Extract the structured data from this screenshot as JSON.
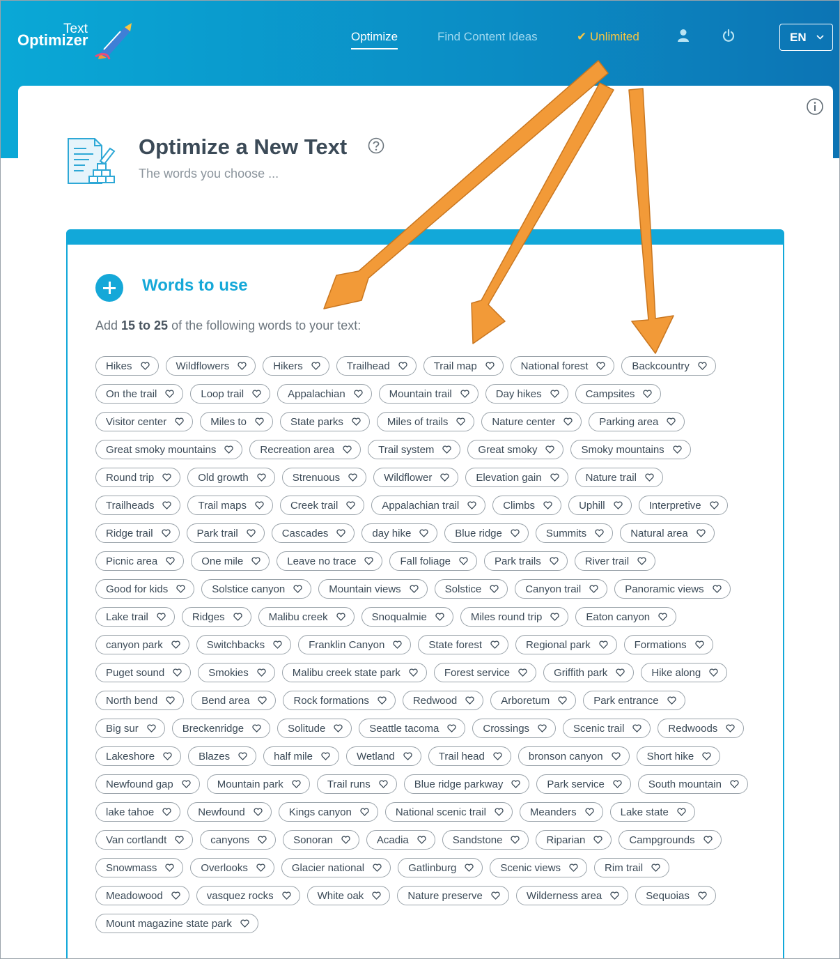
{
  "header": {
    "logo_small": "Text",
    "logo_big": "Optimizer",
    "nav": {
      "optimize": "Optimize",
      "find_content": "Find Content Ideas",
      "unlimited": "✔ Unlimited"
    },
    "language": "EN",
    "icons": [
      "user-icon",
      "power-icon",
      "chevron-down-icon"
    ]
  },
  "page": {
    "title": "Optimize a New Text",
    "subtitle": "The words you choose ...",
    "icons": [
      "info-icon",
      "help-icon",
      "document-edit-icon"
    ]
  },
  "panel": {
    "heading": "Words to use",
    "instruction_prefix": "Add ",
    "instruction_range": "15 to 25",
    "instruction_suffix": " of the following words to your text:",
    "words": [
      "Hikes",
      "Wildflowers",
      "Hikers",
      "Trailhead",
      "Trail map",
      "National forest",
      "Backcountry",
      "On the trail",
      "Loop trail",
      "Appalachian",
      "Mountain trail",
      "Day hikes",
      "Campsites",
      "Visitor center",
      "Miles to",
      "State parks",
      "Miles of trails",
      "Nature center",
      "Parking area",
      "Great smoky mountains",
      "Recreation area",
      "Trail system",
      "Great smoky",
      "Smoky mountains",
      "Round trip",
      "Old growth",
      "Strenuous",
      "Wildflower",
      "Elevation gain",
      "Nature trail",
      "Trailheads",
      "Trail maps",
      "Creek trail",
      "Appalachian trail",
      "Climbs",
      "Uphill",
      "Interpretive",
      "Ridge trail",
      "Park trail",
      "Cascades",
      "day hike",
      "Blue ridge",
      "Summits",
      "Natural area",
      "Picnic area",
      "One mile",
      "Leave no trace",
      "Fall foliage",
      "Park trails",
      "River trail",
      "Good for kids",
      "Solstice canyon",
      "Mountain views",
      "Solstice",
      "Canyon trail",
      "Panoramic views",
      "Lake trail",
      "Ridges",
      "Malibu creek",
      "Snoqualmie",
      "Miles round trip",
      "Eaton canyon",
      "canyon park",
      "Switchbacks",
      "Franklin Canyon",
      "State forest",
      "Regional park",
      "Formations",
      "Puget sound",
      "Smokies",
      "Malibu creek state park",
      "Forest service",
      "Griffith park",
      "Hike along",
      "North bend",
      "Bend area",
      "Rock formations",
      "Redwood",
      "Arboretum",
      "Park entrance",
      "Big sur",
      "Breckenridge",
      "Solitude",
      "Seattle tacoma",
      "Crossings",
      "Scenic trail",
      "Redwoods",
      "Lakeshore",
      "Blazes",
      "half mile",
      "Wetland",
      "Trail head",
      "bronson canyon",
      "Short hike",
      "Newfound gap",
      "Mountain park",
      "Trail runs",
      "Blue ridge parkway",
      "Park service",
      "South mountain",
      "lake tahoe",
      "Newfound",
      "Kings canyon",
      "National scenic trail",
      "Meanders",
      "Lake state",
      "Van cortlandt",
      "canyons",
      "Sonoran",
      "Acadia",
      "Sandstone",
      "Riparian",
      "Campgrounds",
      "Snowmass",
      "Overlooks",
      "Glacier national",
      "Gatlinburg",
      "Scenic views",
      "Rim trail",
      "Meadowood",
      "vasquez rocks",
      "White oak",
      "Nature preserve",
      "Wilderness area",
      "Sequoias",
      "Mount magazine state park"
    ]
  },
  "colors": {
    "header_blue": "#0b8cc4",
    "accent_blue": "#15a8d8",
    "unlimited_gold": "#f6c542",
    "annotation_orange": "#f29a38"
  }
}
